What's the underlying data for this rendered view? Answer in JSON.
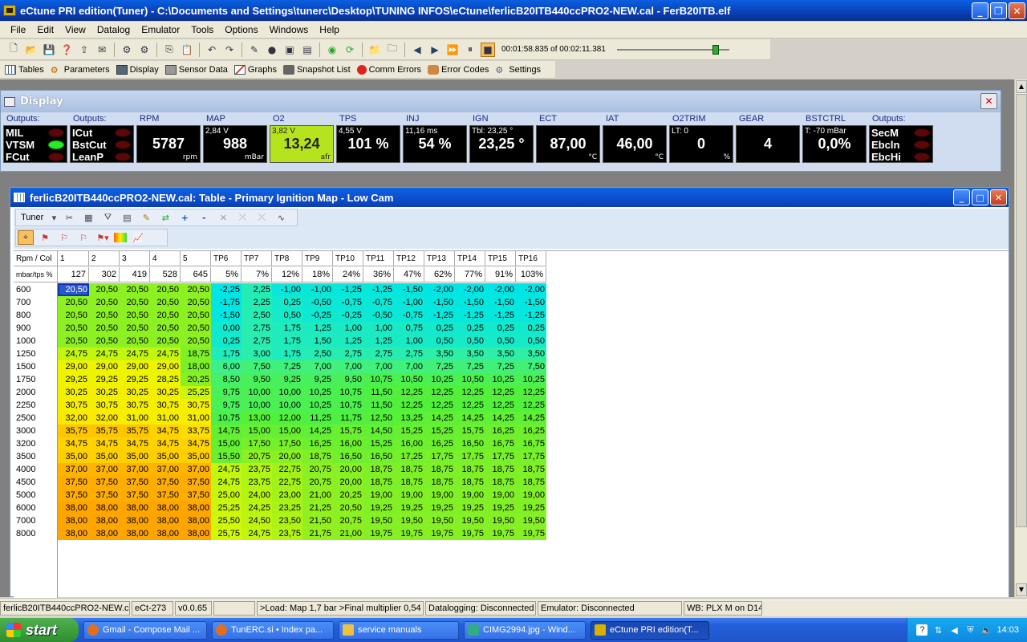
{
  "titlebar": {
    "title": "eCtune PRI edition(Tuner) - C:\\Documents and Settings\\tunerc\\Desktop\\TUNING INFOS\\eCtune\\ferlicB20ITB440ccPRO2-NEW.cal - FerB20ITB.elf"
  },
  "menu": [
    "File",
    "Edit",
    "View",
    "Datalog",
    "Emulator",
    "Tools",
    "Options",
    "Windows",
    "Help"
  ],
  "toolbar": {
    "time": "00:01:58.835 of 00:02:11.381",
    "playback_position": 0.9
  },
  "toolbar2": [
    "Tables",
    "Parameters",
    "Display",
    "Sensor Data",
    "Graphs",
    "Snapshot List",
    "Comm Errors",
    "Error Codes",
    "Settings"
  ],
  "display": {
    "title": "Display",
    "out1": {
      "label": "Outputs:",
      "rows": [
        "MIL",
        "VTSM",
        "FCut"
      ],
      "leds": [
        false,
        true,
        false
      ]
    },
    "out2": {
      "label": "Outputs:",
      "rows": [
        "ICut",
        "BstCut",
        "LeanP"
      ],
      "leds": [
        false,
        false,
        false
      ]
    },
    "out3": {
      "label": "Outputs:",
      "rows": [
        "SecM",
        "Ebcln",
        "EbcHi"
      ],
      "leds": [
        false,
        false,
        false
      ]
    },
    "gauges": [
      {
        "label": "RPM",
        "sub": "",
        "value": "5787",
        "unit": "rpm"
      },
      {
        "label": "MAP",
        "sub": "2,84 V",
        "value": "988",
        "unit": "mBar"
      },
      {
        "label": "O2",
        "sub": "3,82 V",
        "value": "13,24",
        "unit": "afr"
      },
      {
        "label": "TPS",
        "sub": "4,55 V",
        "value": "101 %",
        "unit": ""
      },
      {
        "label": "INJ",
        "sub": "11,16 ms",
        "value": "54 %",
        "unit": ""
      },
      {
        "label": "IGN",
        "sub": "Tbl: 23,25 °",
        "value": "23,25 °",
        "unit": ""
      },
      {
        "label": "ECT",
        "sub": "",
        "value": "87,00",
        "unit": "°C"
      },
      {
        "label": "IAT",
        "sub": "",
        "value": "46,00",
        "unit": "°C"
      },
      {
        "label": "O2TRIM",
        "sub": "LT: 0",
        "value": "0",
        "unit": "%"
      },
      {
        "label": "GEAR",
        "sub": "",
        "value": "4",
        "unit": ""
      },
      {
        "label": "BSTCTRL",
        "sub": "T: -70 mBar",
        "value": "0,0%",
        "unit": ""
      }
    ],
    "colors": {
      "o2_highlight": "#b5e31e",
      "led_on": "#2be82b",
      "led_off": "#5a0808"
    }
  },
  "table": {
    "title": "ferlicB20ITB440ccPRO2-NEW.cal: Table - Primary Ignition Map - Low Cam",
    "tuner_label": "Tuner",
    "corner1": "Rpm / Col",
    "corner2": "mbar/tps %",
    "col_names": [
      "1",
      "2",
      "3",
      "4",
      "5",
      "TP6",
      "TP7",
      "TP8",
      "TP9",
      "TP10",
      "TP11",
      "TP12",
      "TP13",
      "TP14",
      "TP15",
      "TP16"
    ],
    "col_values": [
      "127",
      "302",
      "419",
      "528",
      "645",
      "5%",
      "7%",
      "12%",
      "18%",
      "24%",
      "36%",
      "47%",
      "62%",
      "77%",
      "91%",
      "103%"
    ],
    "rows": [
      "600",
      "700",
      "800",
      "900",
      "1000",
      "1250",
      "1500",
      "1750",
      "2000",
      "2250",
      "2500",
      "3000",
      "3200",
      "3500",
      "4000",
      "4500",
      "5000",
      "6000",
      "7000",
      "8000"
    ],
    "cells": [
      [
        "20,50",
        "20,50",
        "20,50",
        "20,50",
        "20,50",
        "-2,25",
        "2,25",
        "-1,00",
        "-1,00",
        "-1,25",
        "-1,25",
        "-1,50",
        "-2,00",
        "-2,00",
        "-2,00",
        "-2,00"
      ],
      [
        "20,50",
        "20,50",
        "20,50",
        "20,50",
        "20,50",
        "-1,75",
        "2,25",
        "0,25",
        "-0,50",
        "-0,75",
        "-0,75",
        "-1,00",
        "-1,50",
        "-1,50",
        "-1,50",
        "-1,50"
      ],
      [
        "20,50",
        "20,50",
        "20,50",
        "20,50",
        "20,50",
        "-1,50",
        "2,50",
        "0,50",
        "-0,25",
        "-0,25",
        "-0,50",
        "-0,75",
        "-1,25",
        "-1,25",
        "-1,25",
        "-1,25"
      ],
      [
        "20,50",
        "20,50",
        "20,50",
        "20,50",
        "20,50",
        "0,00",
        "2,75",
        "1,75",
        "1,25",
        "1,00",
        "1,00",
        "0,75",
        "0,25",
        "0,25",
        "0,25",
        "0,25"
      ],
      [
        "20,50",
        "20,50",
        "20,50",
        "20,50",
        "20,50",
        "0,25",
        "2,75",
        "1,75",
        "1,50",
        "1,25",
        "1,25",
        "1,00",
        "0,50",
        "0,50",
        "0,50",
        "0,50"
      ],
      [
        "24,75",
        "24,75",
        "24,75",
        "24,75",
        "18,75",
        "1,75",
        "3,00",
        "1,75",
        "2,50",
        "2,75",
        "2,75",
        "2,75",
        "3,50",
        "3,50",
        "3,50",
        "3,50"
      ],
      [
        "29,00",
        "29,00",
        "29,00",
        "29,00",
        "18,00",
        "6,00",
        "7,50",
        "7,25",
        "7,00",
        "7,00",
        "7,00",
        "7,00",
        "7,25",
        "7,25",
        "7,25",
        "7,50"
      ],
      [
        "29,25",
        "29,25",
        "29,25",
        "28,25",
        "20,25",
        "8,50",
        "9,50",
        "9,25",
        "9,25",
        "9,50",
        "10,75",
        "10,50",
        "10,25",
        "10,50",
        "10,25",
        "10,25"
      ],
      [
        "30,25",
        "30,25",
        "30,25",
        "30,25",
        "25,25",
        "9,75",
        "10,00",
        "10,00",
        "10,25",
        "10,75",
        "11,50",
        "12,25",
        "12,25",
        "12,25",
        "12,25",
        "12,25"
      ],
      [
        "30,75",
        "30,75",
        "30,75",
        "30,75",
        "30,75",
        "9,75",
        "10,00",
        "10,00",
        "10,25",
        "10,75",
        "11,50",
        "12,25",
        "12,25",
        "12,25",
        "12,25",
        "12,25"
      ],
      [
        "32,00",
        "32,00",
        "31,00",
        "31,00",
        "31,00",
        "10,75",
        "13,00",
        "12,00",
        "11,25",
        "11,75",
        "12,50",
        "13,25",
        "14,25",
        "14,25",
        "14,25",
        "14,25"
      ],
      [
        "35,75",
        "35,75",
        "35,75",
        "34,75",
        "33,75",
        "14,75",
        "15,00",
        "15,00",
        "14,25",
        "15,75",
        "14,50",
        "15,25",
        "15,25",
        "15,75",
        "16,25",
        "16,25"
      ],
      [
        "34,75",
        "34,75",
        "34,75",
        "34,75",
        "34,75",
        "15,00",
        "17,50",
        "17,50",
        "16,25",
        "16,00",
        "15,25",
        "16,00",
        "16,25",
        "16,50",
        "16,75",
        "16,75"
      ],
      [
        "35,00",
        "35,00",
        "35,00",
        "35,00",
        "35,00",
        "15,50",
        "20,75",
        "20,00",
        "18,75",
        "16,50",
        "16,50",
        "17,25",
        "17,75",
        "17,75",
        "17,75",
        "17,75"
      ],
      [
        "37,00",
        "37,00",
        "37,00",
        "37,00",
        "37,00",
        "24,75",
        "23,75",
        "22,75",
        "20,75",
        "20,00",
        "18,75",
        "18,75",
        "18,75",
        "18,75",
        "18,75",
        "18,75"
      ],
      [
        "37,50",
        "37,50",
        "37,50",
        "37,50",
        "37,50",
        "24,75",
        "23,75",
        "22,75",
        "20,75",
        "20,00",
        "18,75",
        "18,75",
        "18,75",
        "18,75",
        "18,75",
        "18,75"
      ],
      [
        "37,50",
        "37,50",
        "37,50",
        "37,50",
        "37,50",
        "25,00",
        "24,00",
        "23,00",
        "21,00",
        "20,25",
        "19,00",
        "19,00",
        "19,00",
        "19,00",
        "19,00",
        "19,00"
      ],
      [
        "38,00",
        "38,00",
        "38,00",
        "38,00",
        "38,00",
        "25,25",
        "24,25",
        "23,25",
        "21,25",
        "20,50",
        "19,25",
        "19,25",
        "19,25",
        "19,25",
        "19,25",
        "19,25"
      ],
      [
        "38,00",
        "38,00",
        "38,00",
        "38,00",
        "38,00",
        "25,50",
        "24,50",
        "23,50",
        "21,50",
        "20,75",
        "19,50",
        "19,50",
        "19,50",
        "19,50",
        "19,50",
        "19,50"
      ],
      [
        "38,00",
        "38,00",
        "38,00",
        "38,00",
        "38,00",
        "25,75",
        "24,75",
        "23,75",
        "21,75",
        "21,00",
        "19,75",
        "19,75",
        "19,75",
        "19,75",
        "19,75",
        "19,75"
      ]
    ]
  },
  "statusbar": [
    "ferlicB20ITB440ccPRO2-NEW.cal",
    "eCt-273",
    "v0.0.65",
    "",
    ">Load: Map 1,7 bar >Final multiplier 0,54",
    "Datalogging: Disconnected",
    "Emulator: Disconnected",
    "WB: PLX M on D14"
  ],
  "taskbar": {
    "start": "start",
    "tasks": [
      "Gmail - Compose Mail ...",
      "TunERC.si • Index pa...",
      "service manuals",
      "CIMG2994.jpg - Wind...",
      "eCtune PRI edition(T..."
    ],
    "clock": "14:03"
  }
}
